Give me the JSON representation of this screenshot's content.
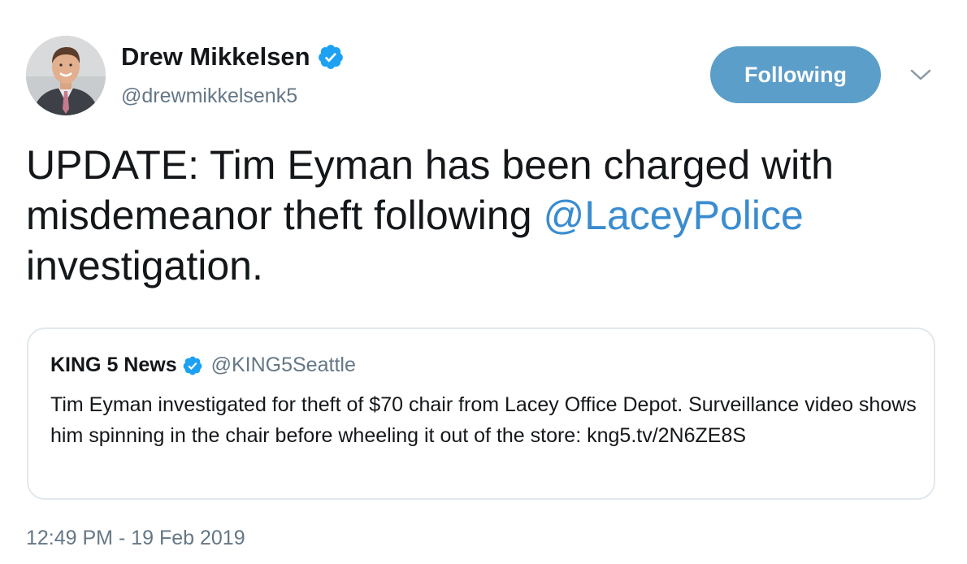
{
  "author": {
    "name": "Drew Mikkelsen",
    "handle": "@drewmikkelsenk5",
    "verified": true
  },
  "follow_button": {
    "label": "Following",
    "color": "#5b9ec9"
  },
  "menu_icon": "chevron-down-icon",
  "tweet": {
    "text_before": "UPDATE: Tim Eyman has been charged with misdemeanor theft following ",
    "mention": "@LaceyPolice",
    "text_after": " investigation."
  },
  "quoted_tweet": {
    "name": "KING 5 News",
    "handle": "@KING5Seattle",
    "verified": true,
    "text": "Tim Eyman investigated for theft of $70 chair from Lacey Office Depot. Surveillance video shows him spinning in the chair before wheeling it out of the store: kng5.tv/2N6ZE8S"
  },
  "timestamp": "12:49 PM - 19 Feb 2019",
  "colors": {
    "text": "#14171a",
    "secondary": "#657786",
    "link": "#3a8ccf",
    "verified": "#1da1f2",
    "border": "#e1e8ed"
  }
}
